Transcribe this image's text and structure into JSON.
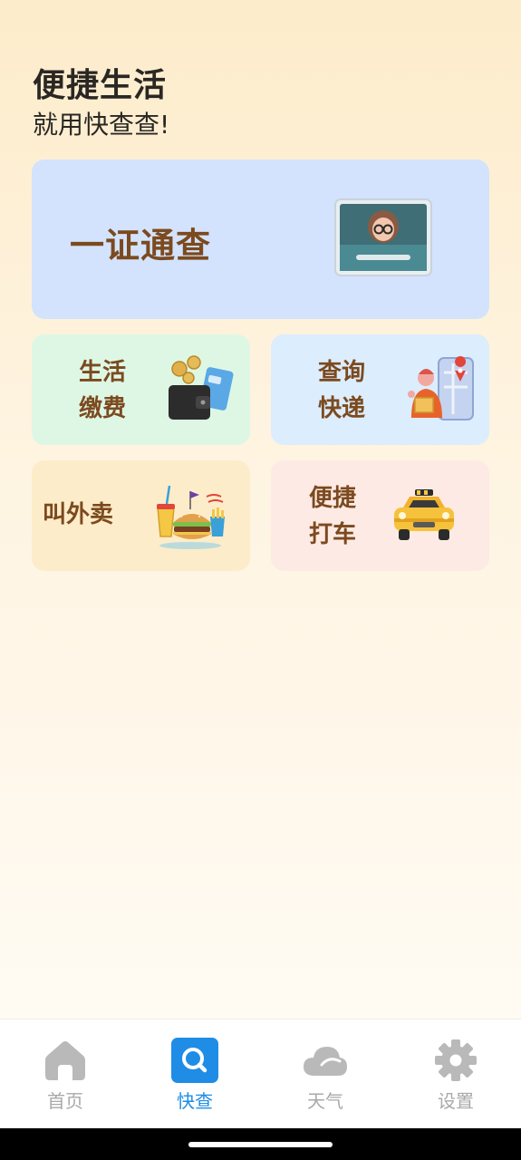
{
  "header": {
    "title": "便捷生活",
    "subtitle": "就用快查查!"
  },
  "cards": {
    "id_check": {
      "label": "一证通查",
      "icon": "id-card-icon"
    },
    "pay": {
      "line1": "生活",
      "line2": "缴费",
      "icon": "wallet-icon"
    },
    "express": {
      "line1": "查询",
      "line2": "快递",
      "icon": "delivery-icon"
    },
    "food": {
      "label": "叫外卖",
      "icon": "fast-food-icon"
    },
    "taxi": {
      "line1": "便捷",
      "line2": "打车",
      "icon": "taxi-icon"
    }
  },
  "tabbar": {
    "active": "快查",
    "active_color": "#1f8de6",
    "inactive_color": "#a9a9a9",
    "items": [
      {
        "label": "首页",
        "icon": "home-icon"
      },
      {
        "label": "快查",
        "icon": "search-icon"
      },
      {
        "label": "天气",
        "icon": "cloud-icon"
      },
      {
        "label": "设置",
        "icon": "gear-icon"
      }
    ]
  },
  "colors": {
    "card_label": "#7b4a1f",
    "main_card_bg": "#d3e3fd",
    "pay_bg": "#def7e5",
    "express_bg": "#dcedfd",
    "food_bg": "#fdecc9",
    "taxi_bg": "#fdeae4"
  }
}
